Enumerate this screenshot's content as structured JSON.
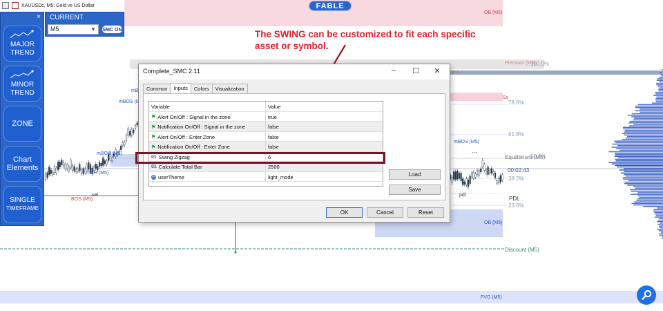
{
  "window": {
    "title": "XAUUSDc, M5:  Gold vs US Dollar"
  },
  "brand": {
    "label": "FABLE"
  },
  "annotation": {
    "line1": "The SWING can be customized to fit each specific",
    "line2": "asset or symbol."
  },
  "left_panel": {
    "close_label": "×",
    "buttons": [
      {
        "line1": "MAJOR",
        "line2": "TREND",
        "icon": "trend-line-icon"
      },
      {
        "line1": "MINOR",
        "line2": "TREND",
        "icon": "trend-line-icon"
      },
      {
        "line1": "ZONE",
        "line2": ""
      },
      {
        "line1": "Chart",
        "line2": "Elements"
      },
      {
        "line1": "SINGLE",
        "line2": "TIMEFRAME"
      }
    ]
  },
  "current_panel": {
    "header": "CURRENT",
    "timeframe": "M5",
    "smc_label": "SMC ON"
  },
  "chart_labels": {
    "ob_top": "OB (M5)",
    "premium": "Premium (M5)",
    "premium_fib": "100.0%",
    "fib_786": "78.6%",
    "fib_618": "61.8%",
    "fib_50": "50.0%",
    "fib_382": "38.2%",
    "fib_236": "23.6%",
    "equilibrium": "Equilibrium (M5)",
    "time_left": "00:02:43",
    "pdl": "PDL",
    "ob_bottom": "OB (M5)",
    "discount": "Discount (M5)",
    "fvg": "FVG (M5)",
    "mbos_1": "mBOS (M5)",
    "mbos_2": "mBOS (M5)",
    "mbos_3": "mBOS (M5)",
    "mbos_4": "mBOS (M5)",
    "mch": "mCH (M5)",
    "bos_label": "BOS (M5)",
    "sel": "sel",
    "pdl_small": "pdl",
    "ss_label": "Ss",
    "level_label": "V: 1...",
    "dots": "..."
  },
  "dialog": {
    "title": "Complete_SMC 2.11",
    "tabs": [
      "Common",
      "Inputs",
      "Colors",
      "Visualization"
    ],
    "active_tab": "Inputs",
    "columns": {
      "variable": "Variable",
      "value": "Value"
    },
    "rows": [
      {
        "icon": "flag-icon",
        "variable": "Alert On/Off : Signal in the zone",
        "value": "true"
      },
      {
        "icon": "flag-icon",
        "variable": "Notification On/Off : Signal in the zone",
        "value": "false"
      },
      {
        "icon": "flag-icon",
        "variable": "Alert On/Off : Enter Zone",
        "value": "false"
      },
      {
        "icon": "flag-icon",
        "variable": "Notification On/Off : Enter Zone",
        "value": "false"
      },
      {
        "icon": "number-icon",
        "icon_text": "01",
        "variable": "Swing Zigzag",
        "value": "6"
      },
      {
        "icon": "number-icon",
        "icon_text": "01",
        "variable": "Calculate Total Bar",
        "value": "2500"
      },
      {
        "icon": "theme-icon",
        "variable": "userTheme",
        "value": "light_mode"
      }
    ],
    "load_label": "Load",
    "save_label": "Save",
    "ok_label": "OK",
    "cancel_label": "Cancel",
    "reset_label": "Reset"
  },
  "colors": {
    "panel_blue": "#2c66c8",
    "annotation_red": "#e0202a",
    "highlight": "#7a1420",
    "ob_pink": "#f7d2da",
    "ob_blue": "#cdd8f5",
    "profile_blue": "#3a5fc8"
  }
}
